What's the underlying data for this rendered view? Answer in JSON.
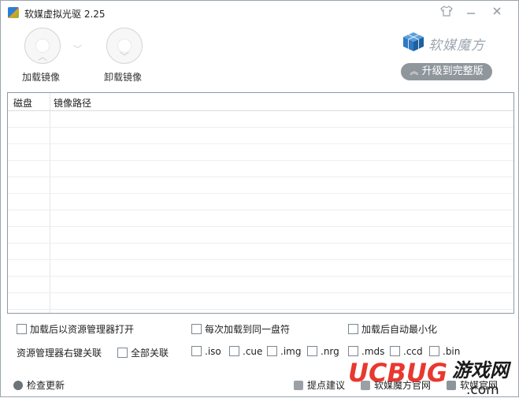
{
  "window": {
    "title": "软媒虚拟光驱 2.25"
  },
  "titlebar": {
    "skin_icon": "shirt-icon",
    "minimize_icon": "minimize-icon",
    "close_icon": "close-icon"
  },
  "toolbar": {
    "mount_label": "加载镜像",
    "unmount_label": "卸载镜像",
    "dropdown_icon": "chevron-down-icon"
  },
  "brand": {
    "name": "软媒魔方",
    "upgrade_label": "升级到完整版"
  },
  "table": {
    "columns": [
      "磁盘",
      "镜像路径"
    ],
    "rows": []
  },
  "options": {
    "open_explorer": "加载后以资源管理器打开",
    "same_drive": "每次加载到同一盘符",
    "minimize_after": "加载后自动最小化",
    "context_menu_label": "资源管理器右键关联",
    "all_assoc": "全部关联",
    "extensions": [
      ".iso",
      ".cue",
      ".img",
      ".nrg",
      ".mds",
      ".ccd",
      ".bin"
    ]
  },
  "footer": {
    "check_update": "检查更新",
    "suggest": "提点建议",
    "official_site": "软媒魔方官网",
    "partial": "软媒官网"
  },
  "watermark": {
    "text1": "UCBUG",
    "text2": "游戏网",
    "text3": ".com"
  }
}
